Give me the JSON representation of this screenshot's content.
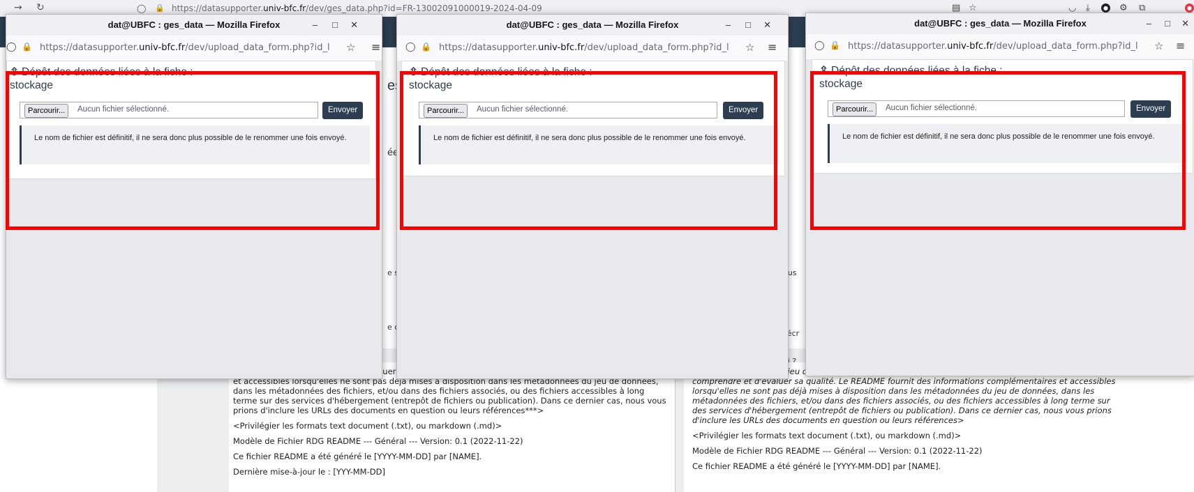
{
  "main_browser": {
    "url_prefix": "https://datasupporter.",
    "url_domain": "univ-bfc.fr",
    "url_suffix": "/dev/ges_data.php?id=FR-13002091000019-2024-04-09"
  },
  "popup": {
    "title": "dat@UBFC : ges_data — Mozilla Firefox",
    "url_prefix": "https://datasupporter.",
    "url_domain": "univ-bfc.fr",
    "url_suffix": "/dev/upload_data_form.php?id_l",
    "heading_line1": "Dépôt des données liées à la fiche :",
    "heading_line2": "stockage",
    "browse_label": "Parcourir...",
    "file_placeholder": "Aucun fichier sélectionné.",
    "send_label": "Envoyer",
    "notice": "Le nom de fichier est définitif, il ne sera donc plus possible de le renommer une fois envoyé."
  },
  "partial_text": {
    "es1": "es",
    "ee": "ée",
    "e_s": "e s",
    "e_c": "e c",
    "or": "or",
    "ous": "ous",
    "ecr": "t écr",
    "oi": "oi ?"
  },
  "left_panel": {
    "p1": "réutilisateur de comprendre et d'évaluer sa qualité. Le README fournit des informations complémentaires et accessibles lorsqu'elles ne sont pas déjà mises à disposition dans les métadonnées du jeu de données, dans les métadonnées des fichiers, et/ou dans des fichiers associés, ou des fichiers accessibles à long terme sur des services d'hébergement (entrepôt de fichiers ou publication). Dans ce dernier cas, nous vous prions d'inclure les URLs des documents en question ou leurs références***>",
    "p2": "<Privilégier les formats text document (.txt), ou markdown (.md)>",
    "p3": "Modèle de Fichier RDG README --- Général --- Version: 0.1 (2022-11-22)",
    "p4": "Ce fichier README a été généré le [YYYY-MM-DD] par [NAME].",
    "p5": "Dernière mise-à-jour le : [YYY-MM-DD]"
  },
  "right_panel": {
    "p1": "La documentation d'un jeu de données doit être suffisante pour permettre à n'importe quel réutilisateur de comprendre et d'évaluer sa qualité. Le README fournit des informations complémentaires et accessibles lorsqu'elles ne sont pas déjà mises à disposition dans les métadonnées du jeu de données, dans les métadonnées des fichiers, et/ou dans des fichiers associés, ou des fichiers accessibles à long terme sur des services d'hébergement (entrepôt de fichiers ou publication). Dans ce dernier cas, nous vous prions d'inclure les URLs des documents en question ou leurs références>",
    "p2": "<Privilégier les formats text document (.txt), ou markdown (.md)>",
    "p3": "Modèle de Fichier RDG README --- Général --- Version: 0.1 (2022-11-22)",
    "p4": "Ce fichier README a été généré le [YYYY-MM-DD] par [NAME]."
  },
  "colors": {
    "highlight": "#ff0000",
    "brand": "#2c3e50"
  }
}
